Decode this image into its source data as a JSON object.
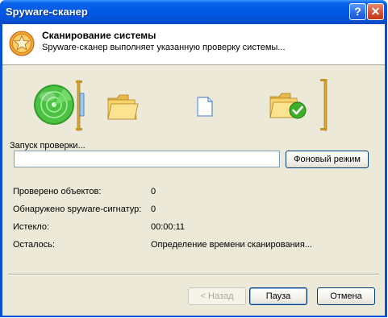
{
  "window": {
    "title": "Spyware-сканер",
    "help_glyph": "?",
    "close_glyph": "✕"
  },
  "header": {
    "title": "Сканирование системы",
    "subtitle": "Spyware-сканер выполняет указанную проверку системы...",
    "icon": "star-shield-icon"
  },
  "scan": {
    "start_label": "Запуск проверки...",
    "progress_percent": 0,
    "background_button": "Фоновый режим"
  },
  "stats": [
    {
      "label": "Проверено объектов:",
      "value": "0"
    },
    {
      "label": "Обнаружено spyware-сигнатур:",
      "value": "0"
    },
    {
      "label": "Истекло:",
      "value": "00:00:11"
    },
    {
      "label": "Осталось:",
      "value": "Определение времени сканирования..."
    }
  ],
  "footer": {
    "back_button": "< Назад",
    "pause_button": "Пауза",
    "cancel_button": "Отмена"
  },
  "colors": {
    "title_blue": "#0058e6",
    "radar_green": "#3ab834",
    "folder_yellow": "#f6c94a",
    "check_green": "#3fae2a"
  }
}
